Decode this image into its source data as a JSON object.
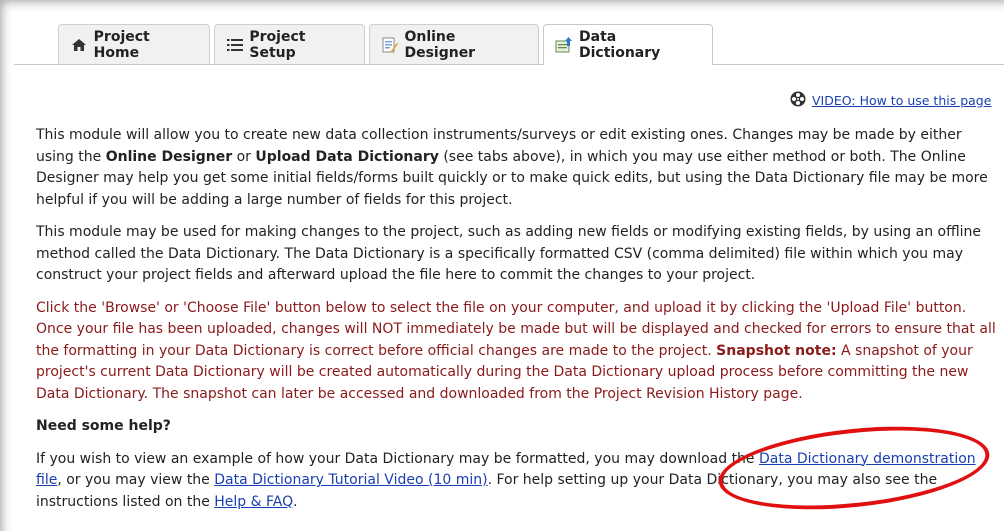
{
  "tabs": [
    {
      "label": "Project Home",
      "icon": "home-icon"
    },
    {
      "label": "Project Setup",
      "icon": "list-icon"
    },
    {
      "label": "Online Designer",
      "icon": "form-edit-icon"
    },
    {
      "label": "Data Dictionary",
      "icon": "upload-file-icon",
      "active": true
    }
  ],
  "video_link": {
    "label": "VIDEO: How to use this page",
    "icon": "film-reel-icon"
  },
  "para1": {
    "t1": "This module will allow you to create new data collection instruments/surveys or edit existing ones. Changes may be made by either using the ",
    "b1": "Online Designer",
    "t2": " or ",
    "b2": "Upload Data Dictionary",
    "t3": " (see tabs above), in which you may use either method or both. The Online Designer may help you get some initial fields/forms built quickly or to make quick edits, but using the Data Dictionary file may be more helpful if you will be adding a large number of fields for this project."
  },
  "para2": "This module may be used for making changes to the project, such as adding new fields or modifying existing fields, by using an offline method called the Data Dictionary. The Data Dictionary is a specifically formatted CSV (comma delimited) file within which you may construct your project fields and afterward upload the file here to commit the changes to your project.",
  "para3": {
    "t1": "Click the 'Browse' or 'Choose File' button below to select the file on your computer, and upload it by clicking the 'Upload File' button. Once your file has been uploaded, changes will NOT immediately be made but will be displayed and checked for errors to ensure that all the formatting in your Data Dictionary is correct before official changes are made to the project. ",
    "b1": "Snapshot note:",
    "t2": " A snapshot of your project's current Data Dictionary will be created automatically during the Data Dictionary upload process before committing the new Data Dictionary. The snapshot can later be accessed and downloaded from the Project Revision History page."
  },
  "help": {
    "title": "Need some help?",
    "t1": "If you wish to view an example of how your Data Dictionary may be formatted, you may download the ",
    "link1": "Data Dictionary demonstration file",
    "t2": ", or you may view the ",
    "link2": "Data Dictionary Tutorial Video (10 min)",
    "t3": ". For help setting up your Data Dictionary, you may also see the instructions listed on the ",
    "link3": "Help & FAQ",
    "t4": "."
  },
  "colors": {
    "annotation_circle": "#e01010",
    "link": "#1a3fb0",
    "note_text": "#8b1a1a"
  }
}
